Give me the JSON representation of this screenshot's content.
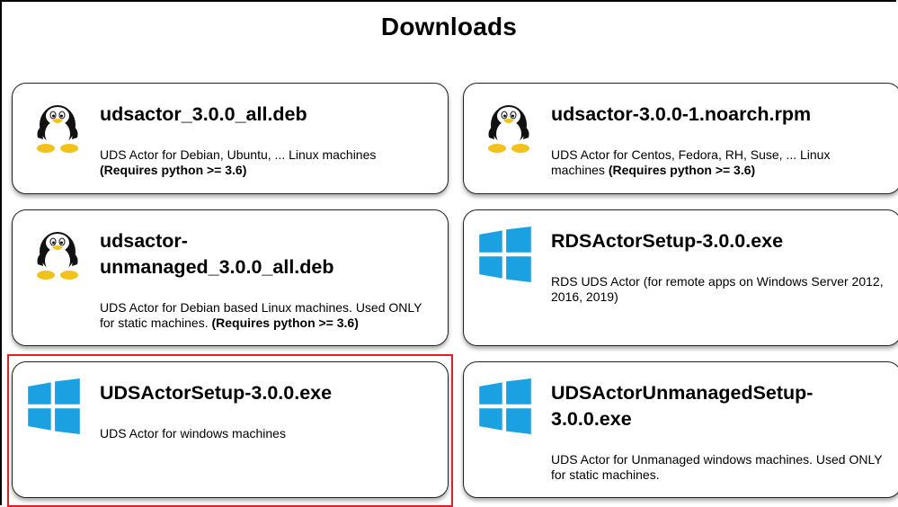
{
  "page": {
    "title": "Downloads"
  },
  "downloads": [
    {
      "name": "udsactor_3.0.0_all.deb",
      "icon": "linux-penguin-icon",
      "description": "UDS Actor for Debian, Ubuntu, ... Linux machines",
      "requirement": "(Requires python >= 3.6)"
    },
    {
      "name": "udsactor-3.0.0-1.noarch.rpm",
      "icon": "linux-penguin-icon",
      "description": "UDS Actor for Centos, Fedora, RH, Suse, ... Linux machines",
      "requirement": "(Requires python >= 3.6)"
    },
    {
      "name": "udsactor-unmanaged_3.0.0_all.deb",
      "icon": "linux-penguin-icon",
      "description": "UDS Actor for Debian based Linux machines. Used ONLY for static machines.",
      "requirement": "(Requires python >= 3.6)"
    },
    {
      "name": "RDSActorSetup-3.0.0.exe",
      "icon": "windows-logo-icon",
      "description": "RDS UDS Actor (for remote apps on Windows Server 2012, 2016, 2019)",
      "requirement": ""
    },
    {
      "name": "UDSActorSetup-3.0.0.exe",
      "icon": "windows-logo-icon",
      "description": "UDS Actor for windows machines",
      "requirement": ""
    },
    {
      "name": "UDSActorUnmanagedSetup-3.0.0.exe",
      "icon": "windows-logo-icon",
      "description": "UDS Actor for Unmanaged windows machines. Used ONLY for static machines.",
      "requirement": ""
    }
  ],
  "colors": {
    "windows_blue": "#1ba1e2",
    "highlight_red": "#e02020",
    "penguin_yellow": "#f2c21b"
  }
}
